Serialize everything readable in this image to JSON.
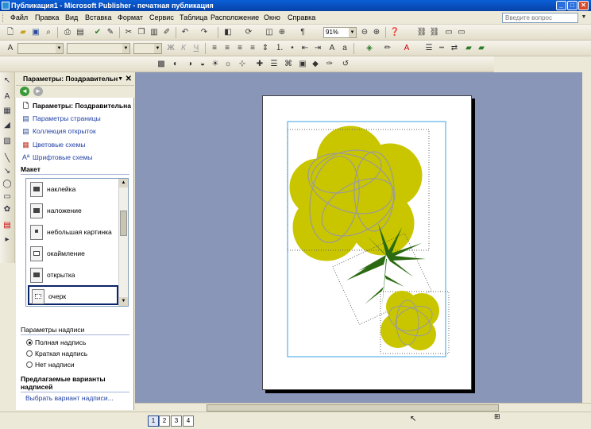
{
  "window": {
    "title": "Публикация1 - Microsoft Publisher - печатная публикация",
    "minimize_label": "_",
    "maximize_label": "□",
    "close_label": "✕"
  },
  "menubar": {
    "items": [
      "Файл",
      "Правка",
      "Вид",
      "Вставка",
      "Формат",
      "Сервис",
      "Таблица",
      "Расположение",
      "Окно",
      "Справка"
    ],
    "ask_placeholder": "Введите вопрос"
  },
  "toolbar": {
    "zoom_value": "91%",
    "bold_label": "Ж",
    "italic_label": "К",
    "underline_label": "Ч"
  },
  "task_pane": {
    "title": "Параметры: Поздравительн",
    "current_item": "Параметры: Поздравительна",
    "links": [
      "Параметры страницы",
      "Коллекция открыток",
      "Цветовые схемы",
      "Шрифтовые схемы"
    ],
    "layout_heading": "Макет",
    "layout_items": [
      "наклейка",
      "наложение",
      "небольшая картинка",
      "окаймление",
      "открытка",
      "очерк"
    ],
    "selected_layout": "очерк",
    "caption_heading": "Параметры надписи",
    "caption_options": [
      {
        "label": "Полная надпись",
        "checked": true
      },
      {
        "label": "Краткая надпись",
        "checked": false
      },
      {
        "label": "Нет надписи",
        "checked": false
      }
    ],
    "suggested_heading_line1": "Предлагаемые варианты",
    "suggested_heading_line2": "надписей",
    "choose_caption_link": "Выбрать вариант надписи..."
  },
  "status_bar": {
    "pages": [
      "1",
      "2",
      "3",
      "4"
    ],
    "active_page": "1"
  },
  "colors": {
    "workspace": "#8a96b8",
    "flower": "#c9c600",
    "leaves": "#2a6a10",
    "link": "#1f3fa5"
  }
}
